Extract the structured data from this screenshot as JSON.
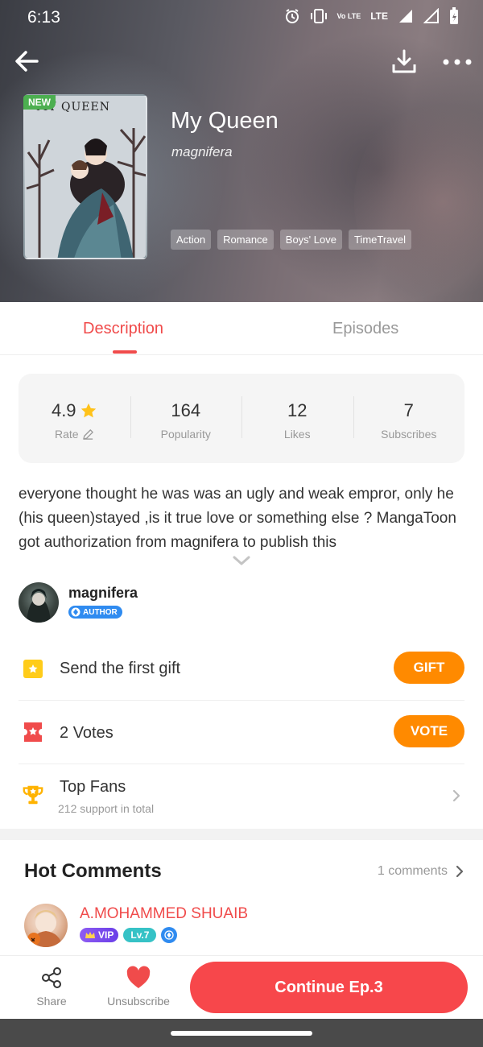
{
  "status_bar": {
    "time": "6:13",
    "icons": [
      "alarm-icon",
      "vibrate-icon",
      "volte-icon",
      "lte-icon",
      "signal-icon",
      "signal-icon",
      "battery-icon"
    ],
    "volte_text": "Vo LTE",
    "lte_text": "LTE"
  },
  "header": {
    "badge": "NEW",
    "cover_title": "MY QUEEN",
    "title": "My Queen",
    "author": "magnifera",
    "tags": [
      "Action",
      "Romance",
      "Boys' Love",
      "TimeTravel"
    ]
  },
  "tabs": [
    {
      "label": "Description",
      "active": true
    },
    {
      "label": "Episodes",
      "active": false
    }
  ],
  "stats": {
    "rate": {
      "value": "4.9",
      "label": "Rate"
    },
    "popularity": {
      "value": "164",
      "label": "Popularity"
    },
    "likes": {
      "value": "12",
      "label": "Likes"
    },
    "subscribes": {
      "value": "7",
      "label": "Subscribes"
    }
  },
  "description": "everyone thought he was was an ugly and weak empror, only he (his queen)stayed ,is it true love or something else ? MangaToon got authorization from magnifera to publish this",
  "author": {
    "name": "magnifera",
    "badge": "AUTHOR"
  },
  "actions": {
    "gift": {
      "text": "Send the first gift",
      "button": "GIFT"
    },
    "vote": {
      "count": "2",
      "text": "Votes",
      "button": "VOTE"
    },
    "fans": {
      "title": "Top Fans",
      "subtitle": "212 support in total"
    }
  },
  "hot_comments": {
    "title": "Hot Comments",
    "count": "1 comments",
    "first": {
      "name": "A.MOHAMMED SHUAIB",
      "vip": "VIP",
      "level": "Lv.7"
    }
  },
  "bottom_bar": {
    "share": "Share",
    "unsubscribe": "Unsubscribe",
    "continue": "Continue Ep.3"
  },
  "colors": {
    "accent_red": "#f04b4b",
    "orange": "#ff8a00",
    "continue": "#f7474b",
    "author_blue": "#2f8bf0"
  }
}
